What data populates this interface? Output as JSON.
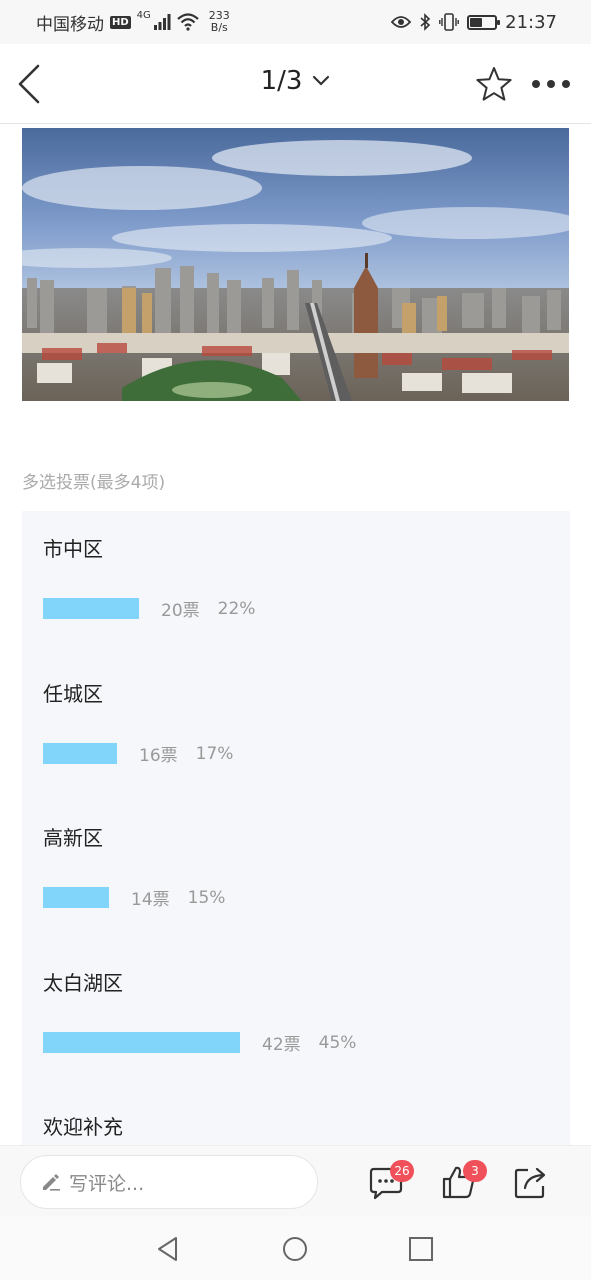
{
  "status": {
    "carrier": "中国移动",
    "hd": "HD",
    "net": "4G",
    "speed_value": "233",
    "speed_unit": "B/s",
    "time": "21:37",
    "battery_level": 0.5
  },
  "nav": {
    "page": "1/3"
  },
  "hero": {
    "icon": "city-skyline-image"
  },
  "poll": {
    "caption": "多选投票(最多4项)",
    "options": [
      {
        "label": "市中区",
        "votes": "20票",
        "percent": "22%",
        "share": 0.22
      },
      {
        "label": "任城区",
        "votes": "16票",
        "percent": "17%",
        "share": 0.17
      },
      {
        "label": "高新区",
        "votes": "14票",
        "percent": "15%",
        "share": 0.15
      },
      {
        "label": "太白湖区",
        "votes": "42票",
        "percent": "45%",
        "share": 0.45
      },
      {
        "label": "欢迎补充"
      }
    ],
    "bar_color": "#81d4fa"
  },
  "bottom": {
    "comment_placeholder": "写评论...",
    "comment_count": "26",
    "like_count": "3",
    "badge_color": "#f0505a"
  }
}
